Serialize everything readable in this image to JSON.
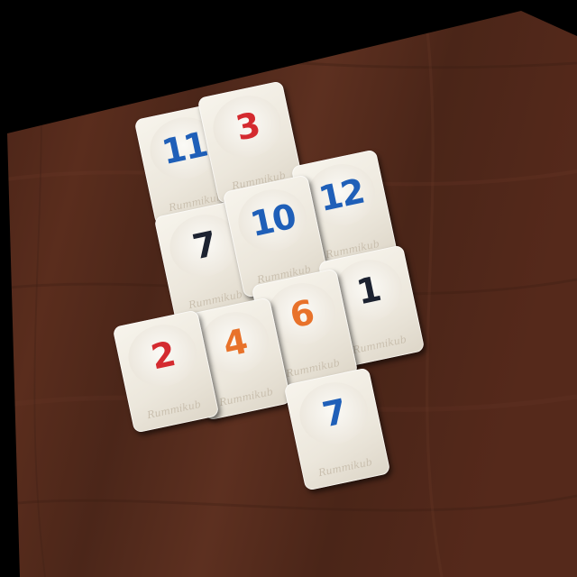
{
  "colors": {
    "blue": "#1f5fb8",
    "red": "#d42a2f",
    "orange": "#e8722a",
    "black": "#1c2230"
  },
  "tiles": [
    {
      "number": "11",
      "color": "blue",
      "brand": "Rummikub"
    },
    {
      "number": "3",
      "color": "red",
      "brand": "Rummikub"
    },
    {
      "number": "12",
      "color": "blue",
      "brand": "Rummikub"
    },
    {
      "number": "7",
      "color": "black",
      "brand": "Rummikub"
    },
    {
      "number": "10",
      "color": "blue",
      "brand": "Rummikub"
    },
    {
      "number": "1",
      "color": "black",
      "brand": "Rummikub"
    },
    {
      "number": "6",
      "color": "orange",
      "brand": "Rummikub"
    },
    {
      "number": "4",
      "color": "orange",
      "brand": "Rummikub"
    },
    {
      "number": "2",
      "color": "red",
      "brand": "Rummikub"
    },
    {
      "number": "7",
      "color": "blue",
      "brand": "Rummikub"
    }
  ]
}
